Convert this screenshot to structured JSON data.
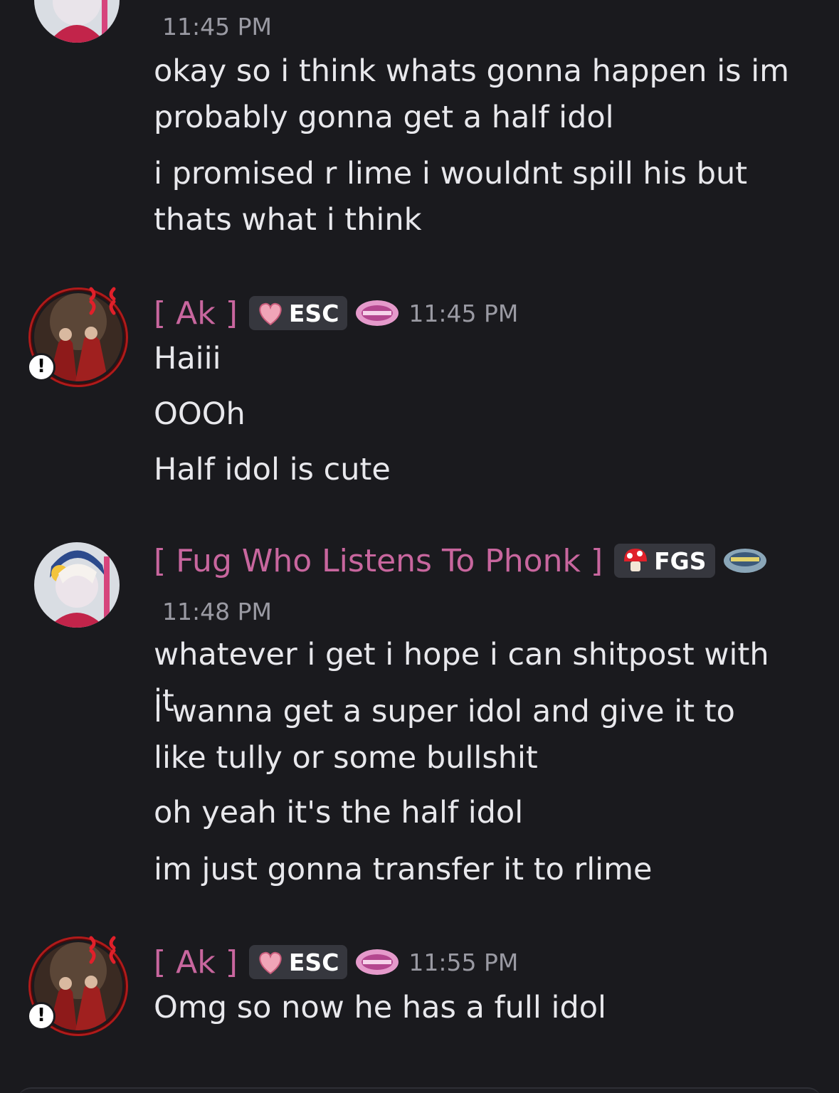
{
  "messages": [
    {
      "time": "11:45 PM",
      "lines": [
        "okay so i think whats gonna happen is im probably gonna get a half idol",
        "i promised r lime i wouldnt spill his but thats what i think"
      ]
    },
    {
      "user": "[ Ak ]",
      "tag": "ESC",
      "time": "11:45 PM",
      "lines": [
        "Haiii",
        "OOOh",
        "Half idol is cute"
      ]
    },
    {
      "user": "[ Fug Who Listens To Phonk ]",
      "tag": "FGS",
      "time": "11:48 PM",
      "lines": [
        "whatever i get i hope i can shitpost with it",
        "i wanna get a super idol and give it to like tully or some bullshit",
        "oh yeah it's the half idol",
        "im just gonna transfer it to rlime"
      ]
    },
    {
      "user": "[ Ak ]",
      "tag": "ESC",
      "time": "11:55 PM",
      "lines": [
        "Omg so now he has a full idol"
      ]
    }
  ],
  "icons": {
    "esc_tag": "heart-icon",
    "fgs_tag": "mushroom-icon",
    "server_badge": "survivor-badge-icon",
    "alert": "exclamation-icon",
    "anger": "anger-mark-icon"
  },
  "alert_glyph": "!",
  "colors": {
    "background": "#1a1a1e",
    "username": "#c8669e",
    "timestamp": "#9a9aa3",
    "text": "#e8e8ec",
    "tag_bg": "#36373e"
  }
}
